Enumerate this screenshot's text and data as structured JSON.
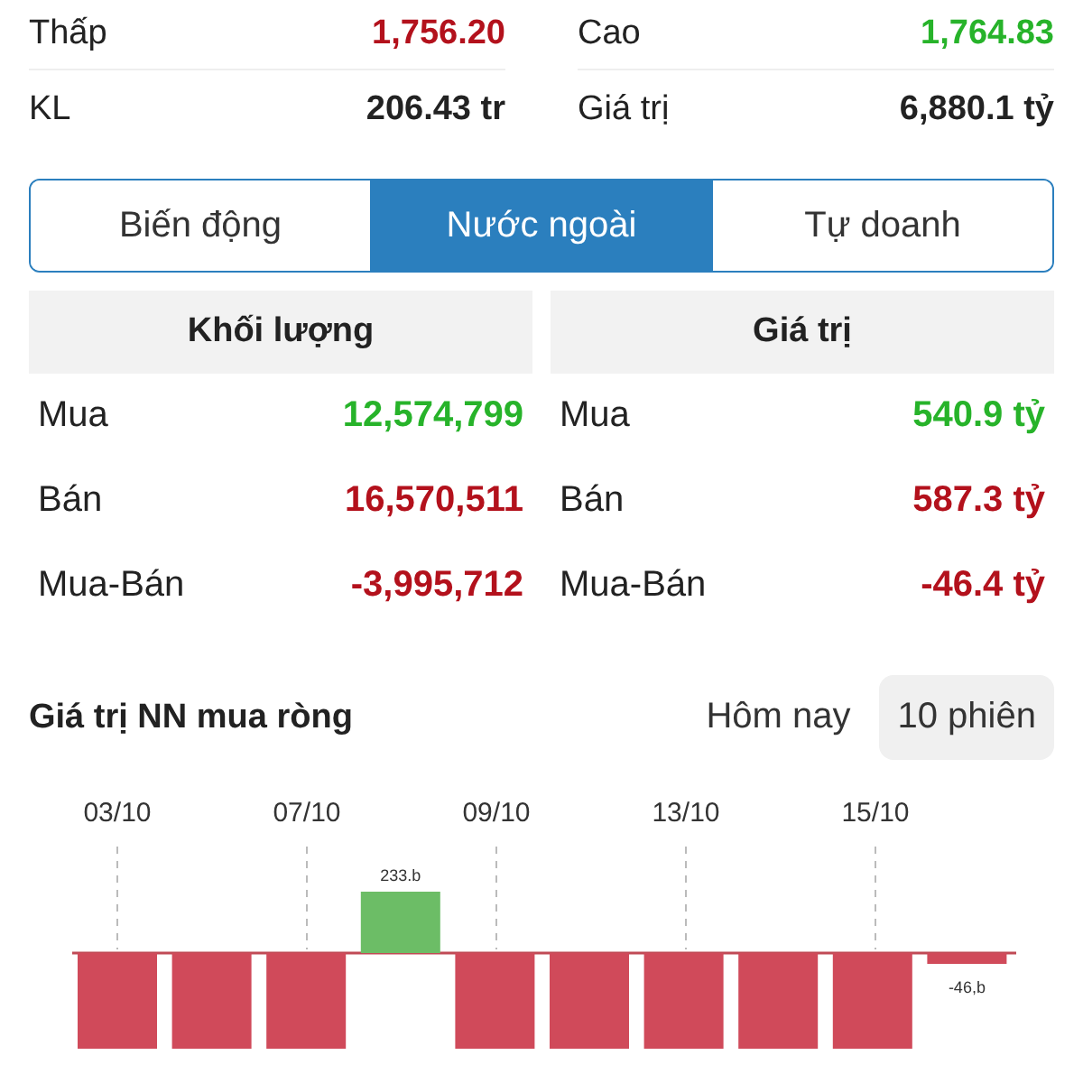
{
  "summary": [
    {
      "label": "Thấp",
      "value": "1,756.20",
      "color": "#b3111c"
    },
    {
      "label": "Cao",
      "value": "1,764.83",
      "color": "#27b32a"
    },
    {
      "label": "KL",
      "value": "206.43 tr",
      "color": "#222222"
    },
    {
      "label": "Giá trị",
      "value": "6,880.1 tỷ",
      "color": "#222222"
    }
  ],
  "tabs": [
    {
      "label": "Biến động",
      "selected": false
    },
    {
      "label": "Nước ngoài",
      "selected": true
    },
    {
      "label": "Tự doanh",
      "selected": false
    }
  ],
  "tables": [
    {
      "title": "Khối lượng",
      "rows": [
        {
          "label": "Mua",
          "value": "12,574,799",
          "color": "#27b32a"
        },
        {
          "label": "Bán",
          "value": "16,570,511",
          "color": "#b3111c"
        },
        {
          "label": "Mua-Bán",
          "value": "-3,995,712",
          "color": "#b3111c"
        }
      ]
    },
    {
      "title": "Giá trị",
      "rows": [
        {
          "label": "Mua",
          "value": "540.9 tỷ",
          "color": "#27b32a"
        },
        {
          "label": "Bán",
          "value": "587.3 tỷ",
          "color": "#b3111c"
        },
        {
          "label": "Mua-Bán",
          "value": "-46.4 tỷ",
          "color": "#b3111c"
        }
      ]
    }
  ],
  "net_chart": {
    "title": "Giá trị NN mua ròng",
    "periods": [
      {
        "label": "Hôm nay",
        "selected": false
      },
      {
        "label": "10 phiên",
        "selected": true
      }
    ],
    "x_labels": [
      "03/10",
      "07/10",
      "09/10",
      "13/10",
      "15/10"
    ],
    "bars": [
      {
        "kind": "sell"
      },
      {
        "kind": "sell"
      },
      {
        "kind": "sell"
      },
      {
        "kind": "buy",
        "label": "233.b"
      },
      {
        "kind": "sell"
      },
      {
        "kind": "sell"
      },
      {
        "kind": "sell"
      },
      {
        "kind": "sell"
      },
      {
        "kind": "sell"
      },
      {
        "kind": "small_sell",
        "label": "-46,b"
      }
    ]
  }
}
